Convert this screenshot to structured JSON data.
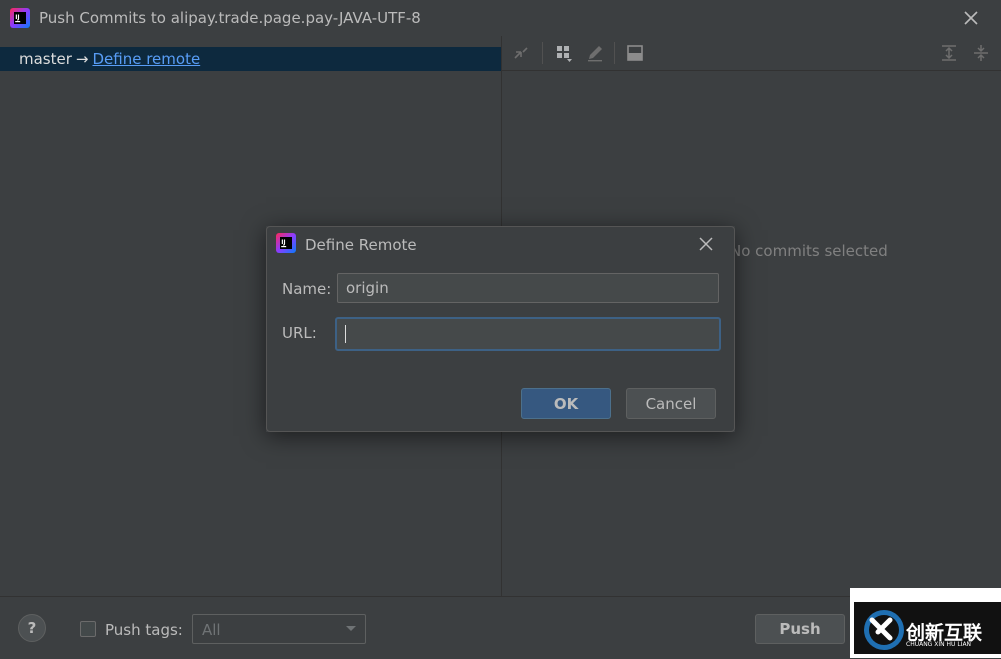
{
  "window": {
    "title": "Push Commits to alipay.trade.page.pay-JAVA-UTF-8"
  },
  "left_pane": {
    "branch": "master",
    "arrow": "→",
    "link": "Define remote"
  },
  "right_pane": {
    "empty_message": "No commits selected",
    "toolbar_icons": [
      "compare-icon",
      "group-by-icon",
      "edit-icon",
      "details-icon",
      "expand-all-icon",
      "collapse-all-icon"
    ]
  },
  "bottom": {
    "help": "?",
    "push_tags_label": "Push tags:",
    "push_tags_checked": false,
    "tags_select_value": "All",
    "push_button": "Push"
  },
  "dialog": {
    "title": "Define Remote",
    "name_label": "Name:",
    "name_value": "origin",
    "url_label": "URL:",
    "url_value": "",
    "ok_button": "OK",
    "cancel_button": "Cancel"
  },
  "watermark": {
    "text": "创新互联",
    "subtext": "CHUANG XIN HU LIAN"
  },
  "colors": {
    "background": "#3c3f41",
    "selection": "#0d293e",
    "link": "#589df6",
    "ok_button": "#365880",
    "focus_border": "#3d6185"
  }
}
